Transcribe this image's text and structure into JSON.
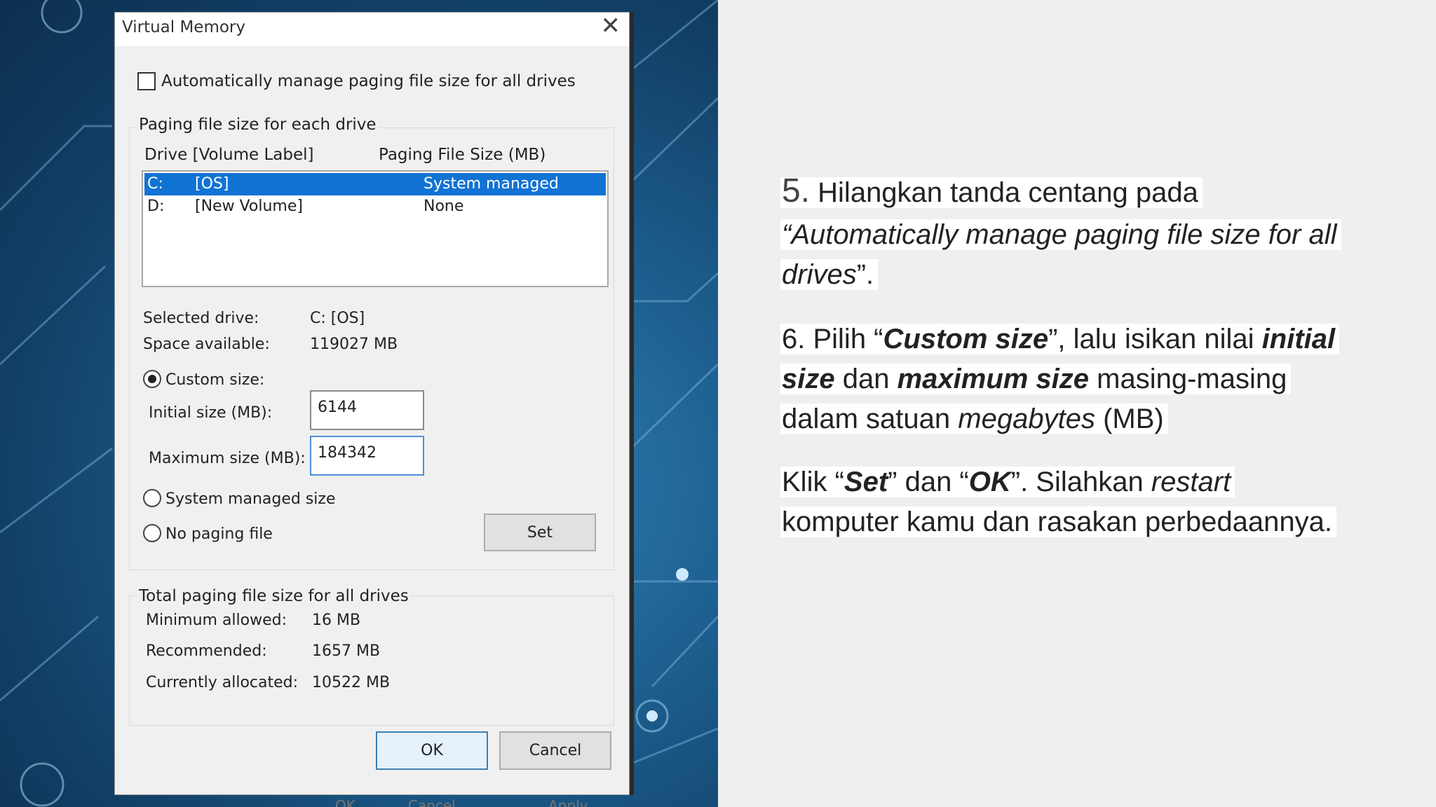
{
  "dialog": {
    "title": "Virtual Memory",
    "close_glyph": "✕",
    "auto_manage_label": "Automatically manage paging file size for all drives",
    "auto_manage_checked": false,
    "group_title": "Paging file size for each drive",
    "col_drive": "Drive  [Volume Label]",
    "col_size": "Paging File Size (MB)",
    "drives": [
      {
        "letter": "C:",
        "label": "[OS]",
        "size": "System managed",
        "selected": true
      },
      {
        "letter": "D:",
        "label": "[New Volume]",
        "size": "None",
        "selected": false
      }
    ],
    "selected_drive_label": "Selected drive:",
    "selected_drive_value": "C:  [OS]",
    "space_available_label": "Space available:",
    "space_available_value": "119027 MB",
    "custom_size_label": "Custom size:",
    "initial_size_label": "Initial size (MB):",
    "initial_size_value": "6144",
    "maximum_size_label": "Maximum size (MB):",
    "maximum_size_value": "184342",
    "system_managed_label": "System managed size",
    "no_paging_label": "No paging file",
    "set_label": "Set",
    "total_group_title": "Total paging file size for all drives",
    "min_allowed_label": "Minimum allowed:",
    "min_allowed_value": "16 MB",
    "recommended_label": "Recommended:",
    "recommended_value": "1657 MB",
    "currently_allocated_label": "Currently allocated:",
    "currently_allocated_value": "10522 MB",
    "ok_label": "OK",
    "cancel_label": "Cancel",
    "ghost_ok": "OK",
    "ghost_cancel": "Cancel",
    "ghost_apply": "Apply"
  },
  "instructions": {
    "step5_number": "5.",
    "step5_text": "Hilangkan tanda centang pada",
    "step5_quote": "“Automatically manage paging file size for all",
    "step5_quote_end": "drives",
    "step5_tail": "”.",
    "step6_prefix": "6.  Pilih “",
    "step6_custom": "Custom size",
    "step6_mid": "”, lalu isikan nilai ",
    "step6_initial": "initial",
    "step6_size": "size",
    "step6_dan": " dan ",
    "step6_max": "maximum size",
    "step6_masing": " masing-masing",
    "step6_dalam": "dalam satuan ",
    "step6_mb_word": "megabytes",
    "step6_mb": " (MB)",
    "klik_prefix": "Klik “",
    "klik_set": "Set",
    "klik_mid": "” dan “",
    "klik_ok": "OK",
    "klik_after": "”. Silahkan ",
    "klik_restart": "restart",
    "klik_line2": "komputer kamu dan rasakan perbedaannya."
  },
  "colors": {
    "selection": "#1173d4",
    "background_panel": "#1d5f8f",
    "page": "#efefee"
  }
}
